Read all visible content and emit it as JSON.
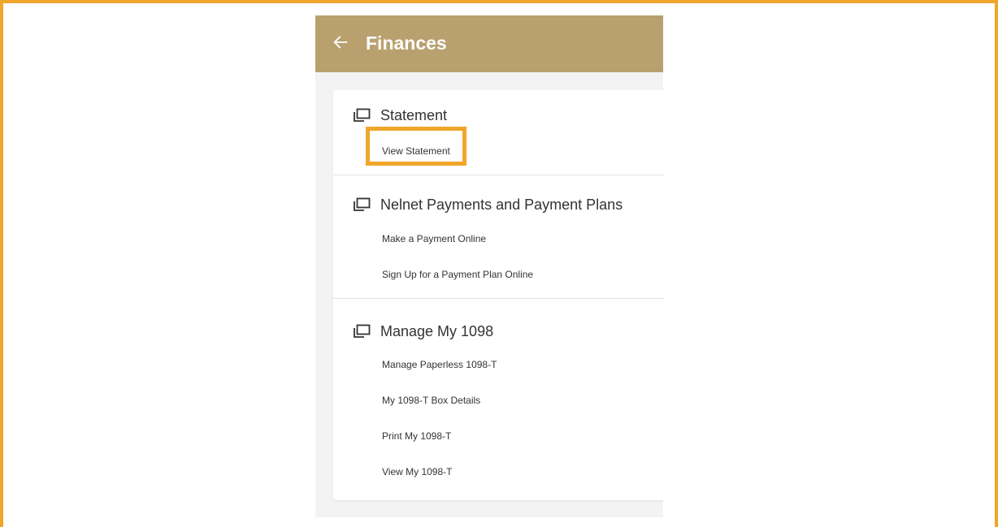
{
  "header": {
    "title": "Finances",
    "back_icon": "arrow-left-icon",
    "background_color": "#b9a06f"
  },
  "sections": [
    {
      "title": "Statement",
      "icon": "copy-window-icon",
      "links": [
        "View Statement"
      ]
    },
    {
      "title": "Nelnet Payments and Payment Plans",
      "icon": "copy-window-icon",
      "links": [
        "Make a Payment Online",
        "Sign Up for a Payment Plan Online"
      ]
    },
    {
      "title": "Manage My 1098",
      "icon": "copy-window-icon",
      "links": [
        "Manage Paperless 1098-T",
        "My 1098-T Box Details",
        "Print My 1098-T",
        "View My 1098-T"
      ]
    }
  ],
  "highlight": {
    "target": "View Statement",
    "color": "#f0a62a"
  }
}
